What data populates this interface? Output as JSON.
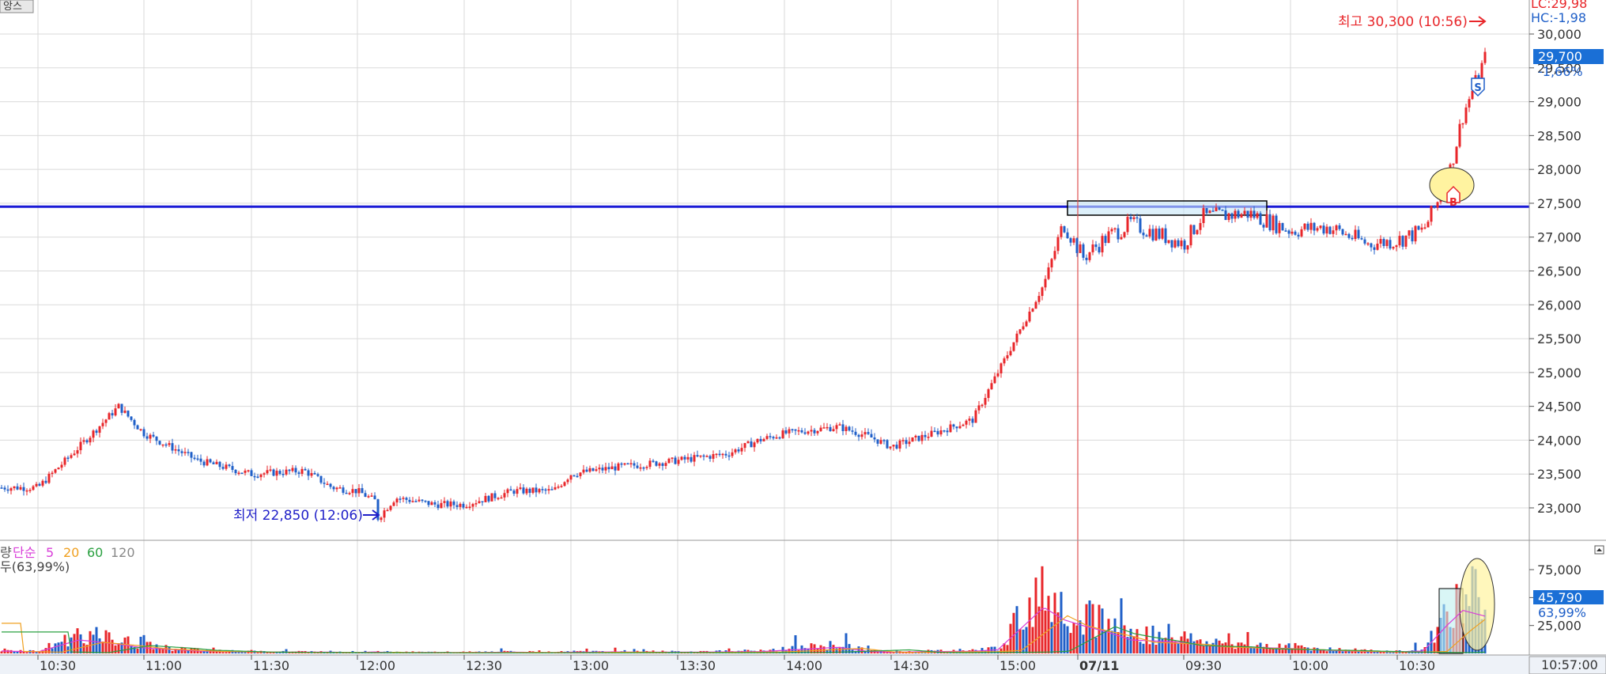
{
  "title_tab": "앙스",
  "header": {
    "lc": "LC:29,98",
    "hc": "HC:-1,98"
  },
  "price": {
    "current_label": "29,700",
    "change_label": "-1,66%",
    "high_annotation": "최고 30,300 (10:56)",
    "low_annotation": "최저 22,850 (12:06)",
    "y_ticks": [
      "30,000",
      "29,500",
      "29,000",
      "28,500",
      "28,000",
      "27,500",
      "27,000",
      "26,500",
      "26,000",
      "25,500",
      "25,000",
      "24,500",
      "24,000",
      "23,500",
      "23,000"
    ],
    "resistance_level": 27450,
    "sell_marker": "S",
    "buy_marker": "B"
  },
  "volume": {
    "legend_prefix": "량",
    "legend_ma": "단순",
    "legend_periods": [
      "5",
      "20",
      "60",
      "120"
    ],
    "legend_line2": "두(63,99%)",
    "y_ticks": [
      "75,000",
      "50,000",
      "25,000"
    ],
    "current_label": "45,790",
    "pct_label": "63,99%"
  },
  "x_axis": {
    "ticks": [
      "10:30",
      "11:00",
      "11:30",
      "12:00",
      "12:30",
      "13:00",
      "13:30",
      "14:00",
      "14:30",
      "15:00",
      "07/11",
      "09:30",
      "10:00",
      "10:30"
    ],
    "cursor_time": "10:57:00"
  },
  "colors": {
    "up": "#e8262a",
    "down": "#1f5fc8",
    "level": "#1a1ad6",
    "accent": "#1a6fd6"
  },
  "chart_data": {
    "type": "line",
    "title": "",
    "xlabel": "",
    "ylabel": "",
    "ylim": [
      22600,
      30300
    ],
    "x": [
      "10:20",
      "10:30",
      "10:40",
      "10:50",
      "11:00",
      "11:10",
      "11:20",
      "11:30",
      "11:40",
      "11:50",
      "12:00",
      "12:06",
      "12:10",
      "12:20",
      "12:30",
      "12:40",
      "12:50",
      "13:00",
      "13:10",
      "13:20",
      "13:30",
      "13:40",
      "13:50",
      "14:00",
      "14:10",
      "14:20",
      "14:30",
      "14:40",
      "14:50",
      "15:00",
      "15:10",
      "15:20",
      "07/11 09:00",
      "09:10",
      "09:20",
      "09:30",
      "09:40",
      "09:50",
      "10:00",
      "10:10",
      "10:20",
      "10:30",
      "10:40",
      "10:45",
      "10:50",
      "10:56"
    ],
    "series": [
      {
        "values": [
          23300,
          23300,
          23900,
          24500,
          24100,
          23700,
          23500,
          23550,
          23300,
          23250,
          23100,
          22850,
          23150,
          23050,
          23050,
          23250,
          23250,
          23500,
          23600,
          23650,
          23700,
          23800,
          24000,
          24100,
          24200,
          24050,
          23900,
          24100,
          24300,
          25000,
          26300,
          27200,
          26700,
          27000,
          27200,
          26900,
          27300,
          27350,
          27100,
          27150,
          26900,
          26950,
          27100,
          27800,
          28800,
          29700
        ]
      }
    ],
    "high": {
      "value": 30300,
      "time": "10:56"
    },
    "low": {
      "value": 22850,
      "time": "12:06"
    },
    "volume": {
      "type": "bar",
      "ylim": [
        0,
        80000
      ],
      "values": [
        4000,
        2500,
        22000,
        15000,
        9000,
        4000,
        2500,
        2000,
        2000,
        1500,
        2500,
        2000,
        1500,
        1500,
        1500,
        2000,
        1500,
        2000,
        2500,
        2000,
        2000,
        2500,
        3000,
        5000,
        10000,
        3000,
        2000,
        3000,
        3500,
        6000,
        75000,
        55000,
        45000,
        35000,
        22000,
        18000,
        13000,
        10000,
        8000,
        5000,
        3000,
        2500,
        4000,
        45790,
        70000,
        60000
      ],
      "current": 45790
    }
  }
}
